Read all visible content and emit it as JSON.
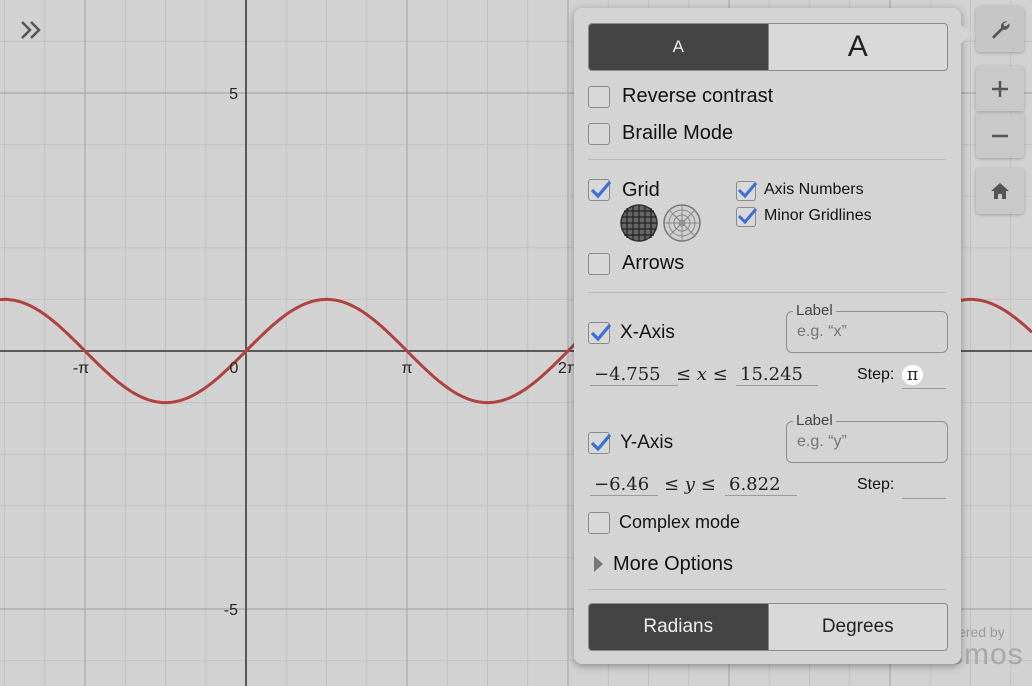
{
  "graph": {
    "y_tick_top": "5",
    "y_tick_bottom": "-5",
    "x_tick_neg_pi": "-π",
    "x_tick_zero": "0",
    "x_tick_pi": "π",
    "x_tick_2pi": "2π",
    "curve_color": "#b0413e"
  },
  "settings": {
    "font_small": "A",
    "font_large": "A",
    "reverse_contrast": "Reverse contrast",
    "braille_mode": "Braille Mode",
    "grid": "Grid",
    "axis_numbers": "Axis Numbers",
    "minor_gridlines": "Minor Gridlines",
    "arrows": "Arrows",
    "x_axis": "X-Axis",
    "x_label_caption": "Label",
    "x_label_placeholder": "e.g. “x”",
    "x_min": "−4.755",
    "x_relation": "≤ x ≤",
    "x_max": "15.245",
    "x_step_label": "Step:",
    "x_step": "π",
    "y_axis": "Y-Axis",
    "y_label_caption": "Label",
    "y_label_placeholder": "e.g. “y”",
    "y_min": "−6.46",
    "y_relation": "≤ y ≤",
    "y_max": "6.822",
    "y_step_label": "Step:",
    "y_step": "",
    "complex_mode": "Complex mode",
    "more_options": "More Options",
    "radians": "Radians",
    "degrees": "Degrees",
    "accent_color": "#3a6fd8"
  },
  "branding": {
    "powered_by": "ered by",
    "logo": "smos"
  }
}
